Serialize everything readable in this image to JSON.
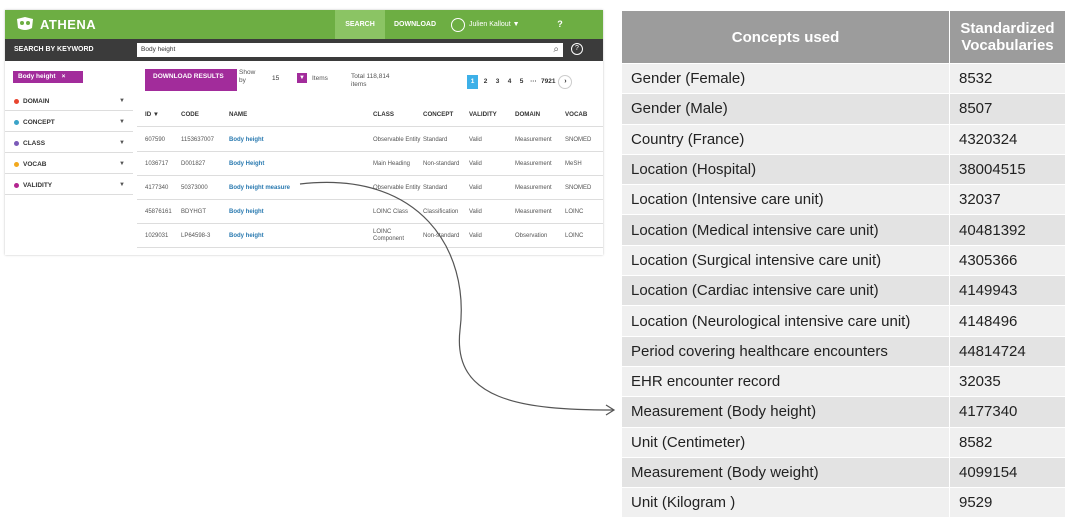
{
  "app": {
    "logo": "ATHENA",
    "nav": {
      "search": "SEARCH",
      "download": "DOWNLOAD",
      "user": "Julien Kallout ▼",
      "help": "?"
    },
    "search_label": "SEARCH BY KEYWORD",
    "search_value": "Body height",
    "chip": "Body height",
    "chip_close": "×",
    "facets": [
      {
        "label": "DOMAIN",
        "color": "#e8452f"
      },
      {
        "label": "CONCEPT",
        "color": "#3aa3c8"
      },
      {
        "label": "CLASS",
        "color": "#7b5ab8"
      },
      {
        "label": "VOCAB",
        "color": "#f2a81d"
      },
      {
        "label": "VALIDITY",
        "color": "#b3248f"
      }
    ],
    "download_btn": "DOWNLOAD RESULTS",
    "show_by": "Show by",
    "per_page": "15",
    "items_label": "Items",
    "total": "Total 118,814 items",
    "pages": [
      "1",
      "2",
      "3",
      "4",
      "5",
      "···",
      "7921"
    ],
    "next": "›",
    "columns": [
      "ID ▼",
      "CODE",
      "NAME",
      "CLASS",
      "CONCEPT",
      "VALIDITY",
      "DOMAIN",
      "VOCAB"
    ],
    "rows": [
      [
        "607590",
        "1153637007",
        "Body height",
        "Observable Entity",
        "Standard",
        "Valid",
        "Measurement",
        "SNOMED"
      ],
      [
        "1036717",
        "D001827",
        "Body Height",
        "Main Heading",
        "Non-standard",
        "Valid",
        "Measurement",
        "MeSH"
      ],
      [
        "4177340",
        "50373000",
        "Body height measure",
        "Observable Entity",
        "Standard",
        "Valid",
        "Measurement",
        "SNOMED"
      ],
      [
        "45876161",
        "BDYHGT",
        "Body height",
        "LOINC Class",
        "Classification",
        "Valid",
        "Measurement",
        "LOINC"
      ],
      [
        "1029031",
        "LP64598-3",
        "Body height",
        "LOINC Component",
        "Non-standard",
        "Valid",
        "Observation",
        "LOINC"
      ]
    ]
  },
  "vocab_table": {
    "headers": [
      "Concepts used",
      "Standardized Vocabularies"
    ],
    "rows": [
      [
        "Gender (Female)",
        "8532"
      ],
      [
        "Gender (Male)",
        "8507"
      ],
      [
        "Country (France)",
        "4320324"
      ],
      [
        "Location (Hospital)",
        "38004515"
      ],
      [
        "Location (Intensive care unit)",
        "32037"
      ],
      [
        "Location (Medical intensive care unit)",
        "40481392"
      ],
      [
        "Location (Surgical intensive care unit)",
        "4305366"
      ],
      [
        "Location (Cardiac intensive care unit)",
        "4149943"
      ],
      [
        "Location (Neurological intensive care unit)",
        "4148496"
      ],
      [
        "Period covering healthcare encounters",
        "44814724"
      ],
      [
        "EHR encounter record",
        "32035"
      ],
      [
        "Measurement (Body height)",
        "4177340"
      ],
      [
        "Unit (Centimeter)",
        "8582"
      ],
      [
        "Measurement (Body weight)",
        "4099154"
      ],
      [
        "Unit (Kilogram )",
        "9529"
      ]
    ]
  },
  "colors": {
    "brand_green": "#6dae43",
    "accent_purple": "#a22c9b",
    "link_blue": "#2a7ab0",
    "header_gray": "#9c9c9c"
  }
}
